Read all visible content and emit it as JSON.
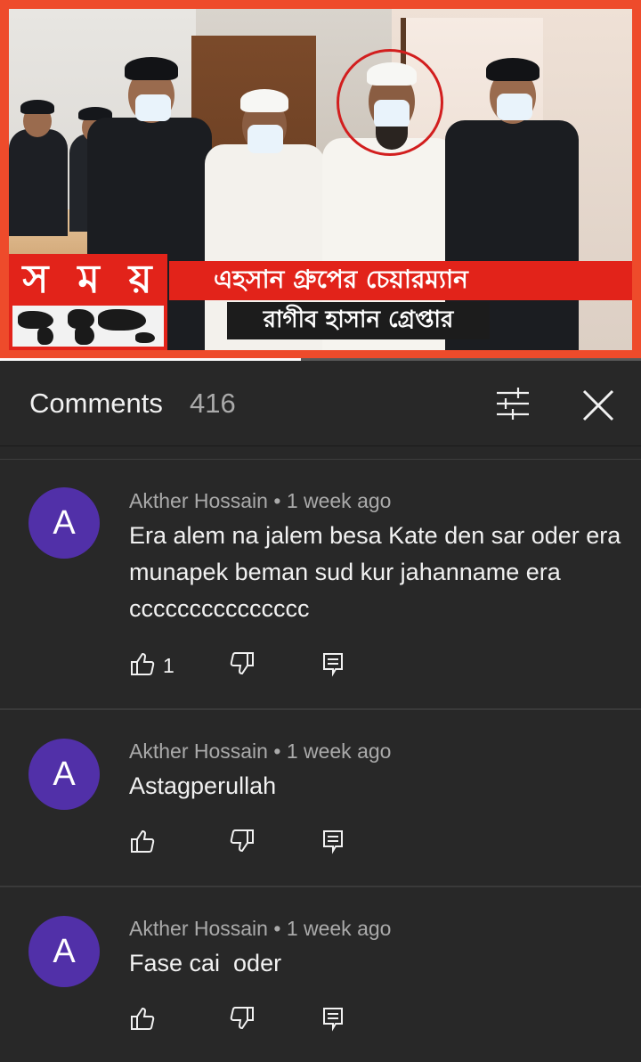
{
  "video": {
    "logo_text": [
      "স",
      "ম",
      "য়"
    ],
    "headline": "এহসান গ্রুপের চেয়ারম্যান",
    "subline": "রাগীব হাসান গ্রেপ্তার",
    "progress_fraction": 0.47
  },
  "header": {
    "title": "Comments",
    "count": "416",
    "filter_icon": "sort-filter-icon",
    "close_icon": "close-icon"
  },
  "comments": [
    {
      "avatar_letter": "A",
      "author": "Akther Hossain",
      "time": "1 week ago",
      "text": "Era alem na jalem besa Kate den sar oder era munapek beman sud kur jahanname era ccccccccccccccc",
      "likes": "1"
    },
    {
      "avatar_letter": "A",
      "author": "Akther Hossain",
      "time": "1 week ago",
      "text": "Astagperullah",
      "likes": ""
    },
    {
      "avatar_letter": "A",
      "author": "Akther Hossain",
      "time": "1 week ago",
      "text": "Fase cai  oder",
      "likes": ""
    }
  ],
  "colors": {
    "background": "#282828",
    "avatar": "#5130a8",
    "news_red": "#e2231a"
  }
}
